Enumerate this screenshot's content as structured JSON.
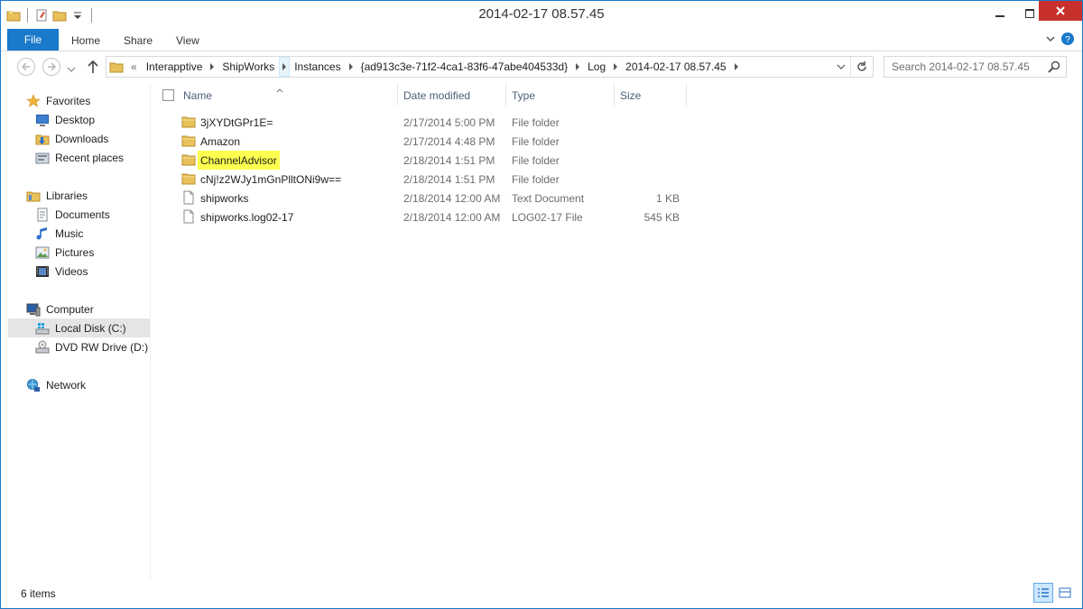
{
  "window": {
    "title": "2014-02-17 08.57.45"
  },
  "ribbon": {
    "tabs": {
      "file": "File",
      "home": "Home",
      "share": "Share",
      "view": "View"
    }
  },
  "address": {
    "overflow": "«",
    "crumbs": [
      "Interapptive",
      "ShipWorks",
      "Instances",
      "{ad913c3e-71f2-4ca1-83f6-47abe404533d}",
      "Log",
      "2014-02-17 08.57.45"
    ]
  },
  "search": {
    "placeholder": "Search 2014-02-17 08.57.45"
  },
  "nav": {
    "favorites": {
      "label": "Favorites",
      "items": [
        "Desktop",
        "Downloads",
        "Recent places"
      ]
    },
    "libraries": {
      "label": "Libraries",
      "items": [
        "Documents",
        "Music",
        "Pictures",
        "Videos"
      ]
    },
    "computer": {
      "label": "Computer",
      "items": [
        "Local Disk (C:)",
        "DVD RW Drive (D:) W"
      ]
    },
    "network": {
      "label": "Network"
    }
  },
  "columns": {
    "name": "Name",
    "date": "Date modified",
    "type": "Type",
    "size": "Size"
  },
  "files": [
    {
      "name": "3jXYDtGPr1E=",
      "date": "2/17/2014 5:00 PM",
      "type": "File folder",
      "size": "",
      "icon": "folder-icon"
    },
    {
      "name": "Amazon",
      "date": "2/17/2014 4:48 PM",
      "type": "File folder",
      "size": "",
      "icon": "folder-icon"
    },
    {
      "name": "ChannelAdvisor",
      "date": "2/18/2014 1:51 PM",
      "type": "File folder",
      "size": "",
      "icon": "folder-icon",
      "highlighted": true
    },
    {
      "name": "cNj!z2WJy1mGnPlltONi9w==",
      "date": "2/18/2014 1:51 PM",
      "type": "File folder",
      "size": "",
      "icon": "folder-icon"
    },
    {
      "name": "shipworks",
      "date": "2/18/2014 12:00 AM",
      "type": "Text Document",
      "size": "1 KB",
      "icon": "document-icon"
    },
    {
      "name": "shipworks.log02-17",
      "date": "2/18/2014 12:00 AM",
      "type": "LOG02-17 File",
      "size": "545 KB",
      "icon": "document-icon"
    }
  ],
  "status": {
    "count": "6 items"
  },
  "colors": {
    "accent": "#1979ca",
    "close": "#c7302c",
    "highlight": "#ffff4f",
    "folder": "#e8c15a"
  }
}
